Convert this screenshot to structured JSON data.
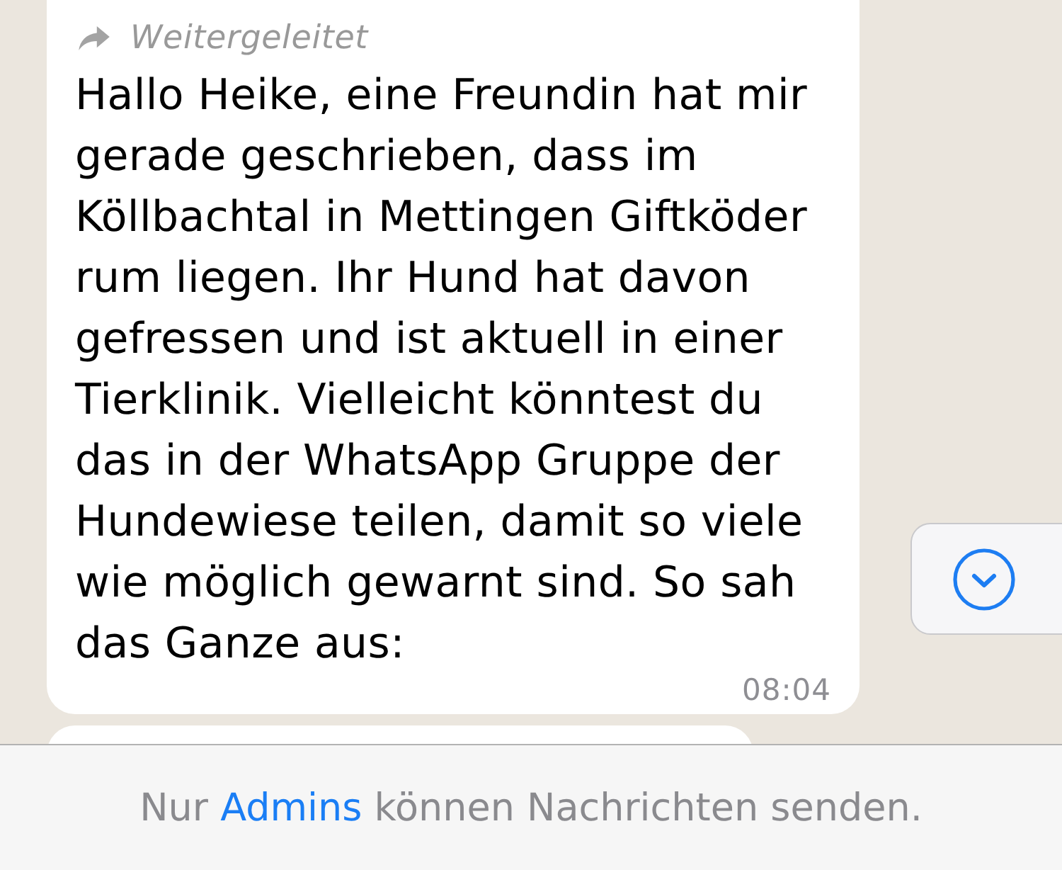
{
  "message": {
    "forwarded": true,
    "forwarded_label": "Weitergeleitet",
    "text": "Hallo Heike, eine Freundin hat mir gerade geschrieben, dass im Köllbachtal in Mettingen Giftköder rum liegen. Ihr Hund hat davon gefressen und ist aktuell in einer Tierklinik. Vielleicht könntest du das in der WhatsApp Gruppe der Hundewiese teilen, damit so viele wie möglich gewarnt sind. So sah das Ganze aus:",
    "time": "08:04"
  },
  "notice": {
    "before": "Nur",
    "link": "Admins",
    "after": "können Nachrichten senden."
  }
}
